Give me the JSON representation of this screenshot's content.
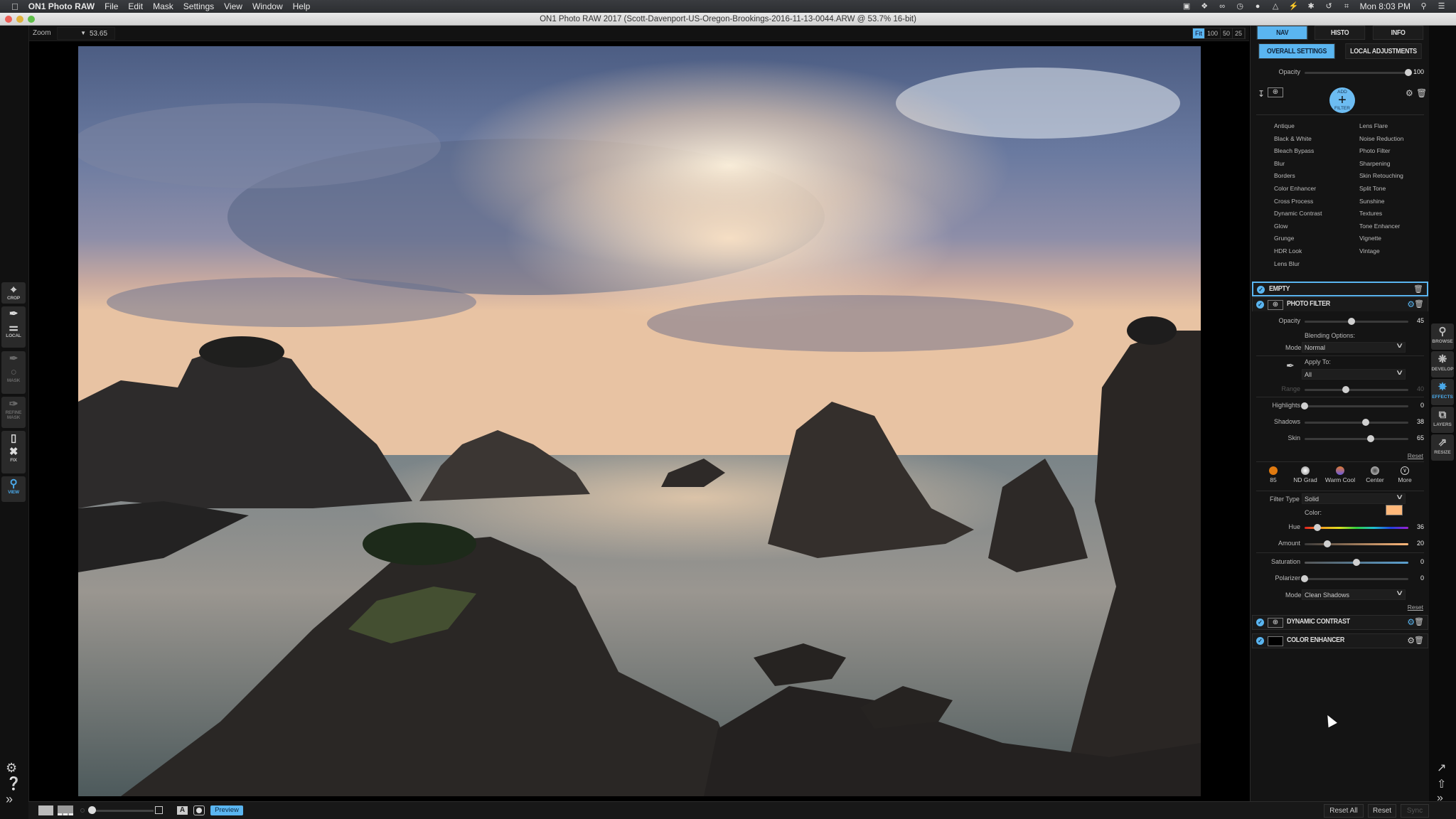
{
  "menubar": {
    "app_name": "ON1 Photo RAW",
    "items": [
      "File",
      "Edit",
      "Mask",
      "Settings",
      "View",
      "Window",
      "Help"
    ],
    "status_icons": [
      "facetime-icon",
      "dropbox-icon",
      "creative-cloud-icon",
      "clock-icon",
      "disk-icon",
      "airplay-icon",
      "bolt-icon",
      "bluetooth-icon",
      "time-machine-icon",
      "wifi-icon"
    ],
    "clock": "Mon 8:03 PM"
  },
  "window": {
    "title": "ON1 Photo RAW 2017 (Scott-Davenport-US-Oregon-Brookings-2016-11-13-0044.ARW @ 53.7% 16-bit)"
  },
  "left_tools": [
    {
      "label": "CROP",
      "icon": "crop-icon",
      "state": "normal"
    },
    {
      "label": "LOCAL",
      "icon": "local-brush-icon",
      "state": "normal"
    },
    {
      "label": "MASK",
      "icon": "mask-brush-icon",
      "state": "dim"
    },
    {
      "label": "REFINE MASK",
      "icon": "refine-mask-icon",
      "state": "dim"
    },
    {
      "label": "FIX",
      "icon": "fix-eraser-icon",
      "state": "normal"
    },
    {
      "label": "VIEW",
      "icon": "magnifier-icon",
      "state": "active"
    }
  ],
  "canvas": {
    "zoom_label": "Zoom",
    "zoom_value": "53.65",
    "zoom_presets": [
      {
        "label": "Fit",
        "active": true
      },
      {
        "label": "100",
        "active": false
      },
      {
        "label": "50",
        "active": false
      },
      {
        "label": "25",
        "active": false
      }
    ],
    "photo_description": "Sunset over rocky sea stacks on the Oregon coast"
  },
  "panel": {
    "top_tabs": [
      {
        "label": "NAV",
        "active": true
      },
      {
        "label": "HISTO",
        "active": false
      },
      {
        "label": "INFO",
        "active": false
      }
    ],
    "sub_tabs": [
      {
        "label": "OVERALL SETTINGS",
        "active": true
      },
      {
        "label": "LOCAL ADJUSTMENTS",
        "active": false
      }
    ],
    "overall_opacity": {
      "label": "Opacity",
      "value": "100",
      "fraction": 1.0
    },
    "add_filter": {
      "top": "ADD",
      "bottom": "FILTER"
    },
    "filters_left": [
      "Antique",
      "Black & White",
      "Bleach Bypass",
      "Blur",
      "Borders",
      "Color Enhancer",
      "Cross Process",
      "Dynamic Contrast",
      "Glow",
      "Grunge",
      "HDR Look",
      "Lens Blur"
    ],
    "filters_right": [
      "Lens Flare",
      "Noise Reduction",
      "Photo Filter",
      "Sharpening",
      "Skin Retouching",
      "Split Tone",
      "Sunshine",
      "Textures",
      "Tone Enhancer",
      "Vignette",
      "Vintage"
    ],
    "layers": [
      {
        "name": "EMPTY",
        "selected": true
      },
      {
        "name": "PHOTO FILTER",
        "selected": false
      },
      {
        "name": "DYNAMIC CONTRAST",
        "selected": false
      },
      {
        "name": "COLOR ENHANCER",
        "selected": false
      }
    ],
    "photo_filter": {
      "opacity": {
        "label": "Opacity",
        "value": "45",
        "fraction": 0.45
      },
      "blending_label": "Blending Options:",
      "mode_label": "Mode",
      "mode_value": "Normal",
      "apply_to_label": "Apply To:",
      "apply_to_value": "All",
      "range": {
        "label": "Range",
        "value": "40",
        "fraction": 0.4
      },
      "highlights": {
        "label": "Highlights",
        "value": "0",
        "fraction": 0.0
      },
      "shadows": {
        "label": "Shadows",
        "value": "38",
        "fraction": 0.59
      },
      "skin": {
        "label": "Skin",
        "value": "65",
        "fraction": 0.64
      },
      "reset_label": "Reset",
      "presets": [
        {
          "label": "85",
          "color": "#e07a10"
        },
        {
          "label": "ND Grad",
          "color": "#c8c8c8"
        },
        {
          "label": "Warm Cool",
          "color": "#8a5ad0"
        },
        {
          "label": "Center",
          "color": "#9a9a9a"
        },
        {
          "label": "More",
          "color": "none"
        }
      ],
      "filter_type_label": "Filter Type",
      "filter_type_value": "Solid",
      "color_label": "Color:",
      "color_value": "#ffb87a",
      "hue": {
        "label": "Hue",
        "value": "36",
        "fraction": 0.12
      },
      "amount": {
        "label": "Amount",
        "value": "20",
        "fraction": 0.22
      },
      "saturation": {
        "label": "Saturation",
        "value": "0",
        "fraction": 0.5
      },
      "polarizer": {
        "label": "Polarizer",
        "value": "0",
        "fraction": 0.0
      },
      "mode2_label": "Mode",
      "mode2_value": "Clean Shadows",
      "reset2_label": "Reset"
    }
  },
  "right_modules": [
    {
      "label": "BROWSE",
      "icon": "browse-icon",
      "active": false
    },
    {
      "label": "DEVELOP",
      "icon": "aperture-icon",
      "active": false
    },
    {
      "label": "EFFECTS",
      "icon": "fx-icon",
      "active": true
    },
    {
      "label": "LAYERS",
      "icon": "layers-icon",
      "active": false
    },
    {
      "label": "RESIZE",
      "icon": "resize-icon",
      "active": false
    }
  ],
  "bottombar": {
    "preview_label": "Preview",
    "a_label": "A",
    "reset_all_label": "Reset All",
    "reset_label": "Reset",
    "sync_label": "Sync"
  },
  "colors": {
    "accent": "#5ab5f0",
    "panel_bg": "#141414"
  }
}
